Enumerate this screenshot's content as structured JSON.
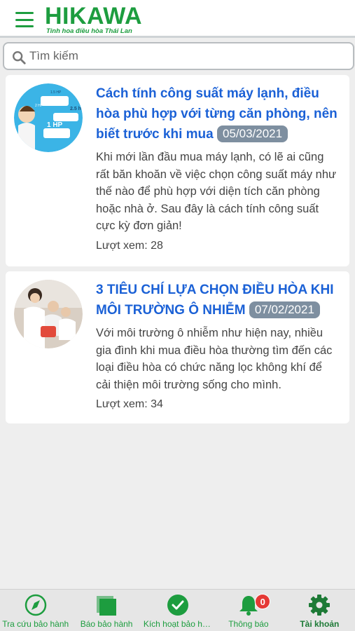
{
  "header": {
    "logo_text": "HIKAWA",
    "logo_tagline": "Tinh hoa điều hòa Thái Lan",
    "brand_color": "#1d9d3f"
  },
  "search": {
    "placeholder": "Tìm kiếm",
    "value": ""
  },
  "articles": [
    {
      "title": "Cách tính công suất máy lạnh, điều hòa phù hợp với từng căn phòng, nên biết trước khi mua",
      "date": "05/03/2021",
      "description": "Khi mới lần đầu mua máy lạnh, có lẽ ai cũng rất băn khoăn về việc chọn công suất máy như thế nào để phù hợp với diện tích căn phòng hoặc nhà ở. Sau đây là cách tính công suất cực kỳ đơn giản!",
      "views": "Lượt xem: 28",
      "thumb_labels": [
        "1 HP",
        "2.5 h",
        "1.5 HP",
        "2 HP"
      ]
    },
    {
      "title": "3 TIÊU CHÍ LỰA CHỌN ĐIỀU HÒA KHI MÔI TRƯỜNG Ô NHIỄM",
      "date": "07/02/2021",
      "description": "Với môi trường ô nhiễm như hiện nay, nhiều gia đình khi mua điều hòa thường tìm đến các loại điều hòa có chức năng lọc không khí để cải thiện môi trường sống cho mình.",
      "views": "Lượt xem: 34"
    }
  ],
  "bottom_nav": {
    "items": [
      {
        "label": "Tra cứu bảo hành",
        "icon": "compass-icon"
      },
      {
        "label": "Báo bảo hành",
        "icon": "stacked-pages-icon"
      },
      {
        "label": "Kích hoạt bảo hà...",
        "icon": "check-circle-icon"
      },
      {
        "label": "Thông báo",
        "icon": "bell-icon",
        "badge": "0"
      },
      {
        "label": "Tài khoản",
        "icon": "gear-icon"
      }
    ],
    "active_index": 4
  }
}
